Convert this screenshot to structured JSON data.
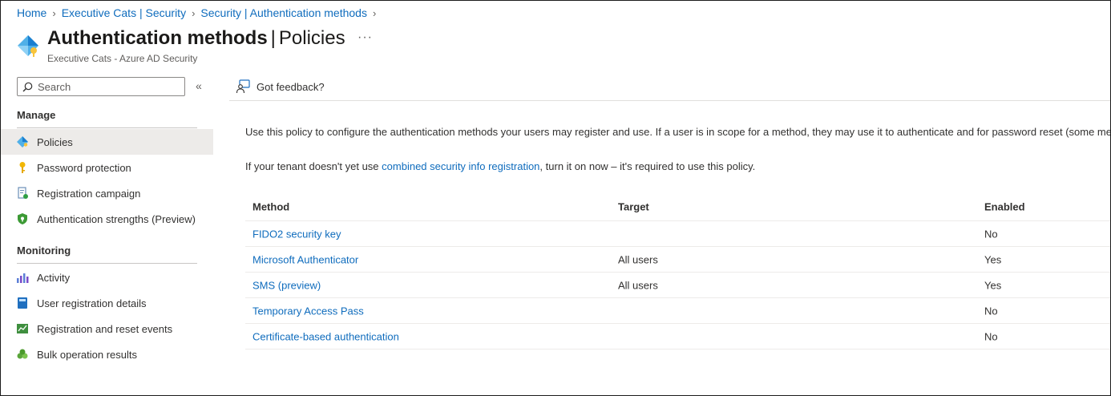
{
  "breadcrumb": [
    "Home",
    "Executive Cats | Security",
    "Security | Authentication methods"
  ],
  "header": {
    "title": "Authentication methods",
    "title_sub": "Policies",
    "subtitle": "Executive Cats - Azure AD Security",
    "more": "···"
  },
  "search": {
    "placeholder": "Search",
    "collapse": "«"
  },
  "nav": {
    "manage_label": "Manage",
    "manage_items": [
      "Policies",
      "Password protection",
      "Registration campaign",
      "Authentication strengths (Preview)"
    ],
    "monitoring_label": "Monitoring",
    "monitoring_items": [
      "Activity",
      "User registration details",
      "Registration and reset events",
      "Bulk operation results"
    ]
  },
  "command_bar": {
    "feedback": "Got feedback?"
  },
  "content": {
    "intro": "Use this policy to configure the authentication methods your users may register and use. If a user is in scope for a method, they may use it to authenticate and for password reset (some met",
    "tenant_pre": "If your tenant doesn't yet use ",
    "tenant_link": "combined security info registration",
    "tenant_post": ", turn it on now – it's required to use this policy."
  },
  "table": {
    "columns": [
      "Method",
      "Target",
      "Enabled"
    ],
    "rows": [
      {
        "method": "FIDO2 security key",
        "target": "",
        "enabled": "No"
      },
      {
        "method": "Microsoft Authenticator",
        "target": "All users",
        "enabled": "Yes"
      },
      {
        "method": "SMS (preview)",
        "target": "All users",
        "enabled": "Yes"
      },
      {
        "method": "Temporary Access Pass",
        "target": "",
        "enabled": "No"
      },
      {
        "method": "Certificate-based authentication",
        "target": "",
        "enabled": "No"
      }
    ]
  },
  "colors": {
    "link": "#0f6cbd",
    "active_bg": "#edebe9",
    "text": "#323130"
  }
}
